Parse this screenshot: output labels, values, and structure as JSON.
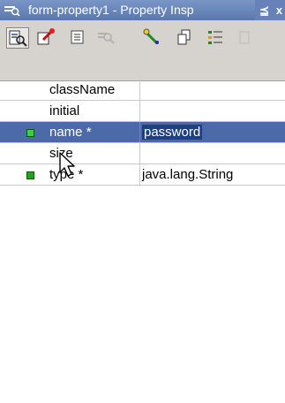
{
  "window": {
    "title": "form-property1 - Property Insp",
    "buttons": [
      "⪳",
      "x"
    ]
  },
  "toolbar": {
    "tools": [
      {
        "icon": "property-inspector-icon",
        "active": true
      },
      {
        "icon": "edit-pin-icon",
        "active": false
      },
      {
        "icon": "list-view-icon",
        "active": false
      },
      {
        "icon": "search-disabled-icon",
        "active": false
      },
      {
        "icon": "wand-icon",
        "active": false
      },
      {
        "icon": "copy-icon",
        "active": false
      },
      {
        "icon": "tree-icon",
        "active": false
      },
      {
        "icon": "extra-disabled-icon",
        "active": false
      }
    ]
  },
  "properties": [
    {
      "name": "className",
      "value": "",
      "required": false
    },
    {
      "name": "initial",
      "value": "",
      "required": false
    },
    {
      "name": "name *",
      "value": "password",
      "required": true,
      "selected": true
    },
    {
      "name": "size",
      "value": "",
      "required": false
    },
    {
      "name": "type *",
      "value": "java.lang.String",
      "required": true
    }
  ],
  "colors": {
    "titlebar": "#6682b8",
    "selected_row": "#4d6aa8",
    "toolbar": "#d6d3ce"
  }
}
